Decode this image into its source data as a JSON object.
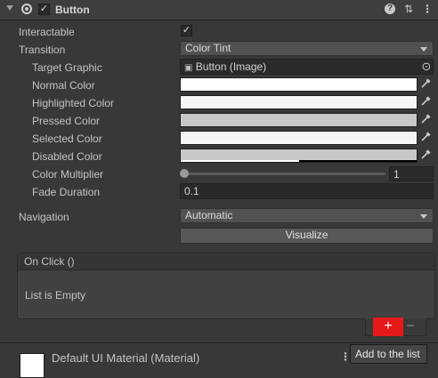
{
  "component": {
    "title": "Button",
    "enabled": true
  },
  "fields": {
    "interactable": {
      "label": "Interactable",
      "checked": true
    },
    "transition": {
      "label": "Transition",
      "value": "Color Tint"
    },
    "target_graphic": {
      "label": "Target Graphic",
      "value": "Button (Image)"
    },
    "normal_color": {
      "label": "Normal Color",
      "color": "#ffffff"
    },
    "highlighted_color": {
      "label": "Highlighted Color",
      "color": "#f5f5f5"
    },
    "pressed_color": {
      "label": "Pressed Color",
      "color": "#c8c8c8"
    },
    "selected_color": {
      "label": "Selected Color",
      "color": "#f5f5f5"
    },
    "disabled_color": {
      "label": "Disabled Color",
      "color": "#c8c8c8",
      "alpha": 0.5
    },
    "color_multiplier": {
      "label": "Color Multiplier",
      "value": "1",
      "fraction": 0.0
    },
    "fade_duration": {
      "label": "Fade Duration",
      "value": "0.1"
    },
    "navigation": {
      "label": "Navigation",
      "value": "Automatic"
    },
    "visualize": {
      "label": "Visualize"
    }
  },
  "on_click": {
    "header": "On Click ()",
    "empty_text": "List is Empty",
    "add_button": "+",
    "remove_button": "−",
    "tooltip": "Add to the list"
  },
  "material": {
    "label": "Default UI Material (Material)"
  },
  "icons": {
    "help": "?",
    "presets": "⇅",
    "menu": "⋮",
    "picker": "⁄",
    "target": "⊙",
    "image": "▣"
  },
  "colors": {
    "accent_add": "#e61919"
  }
}
